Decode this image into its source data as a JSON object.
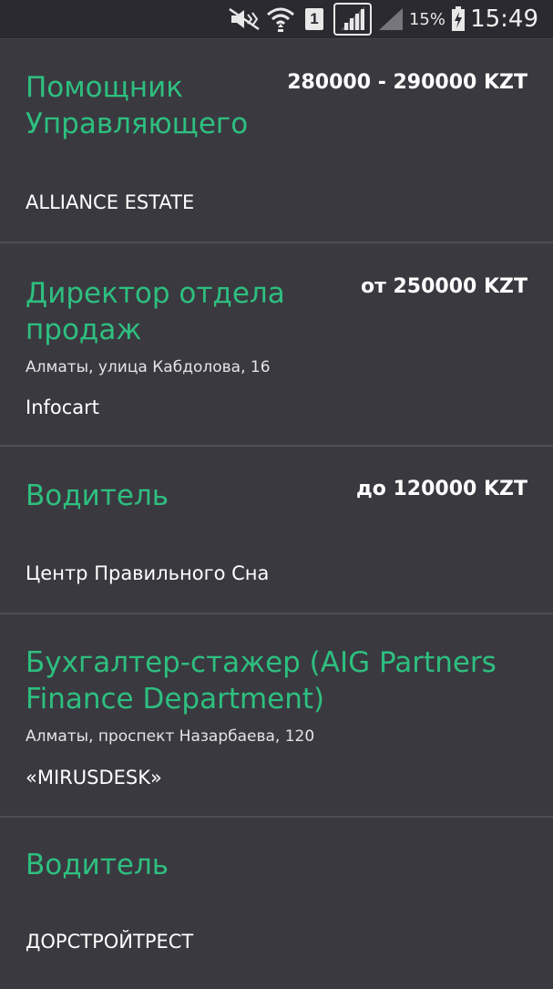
{
  "status_bar": {
    "sim_slot": "1",
    "battery_percent": "15%",
    "time": "15:49",
    "icons": [
      "mute-icon",
      "wifi-icon",
      "sim-icon",
      "signal-icon",
      "signal-weak-icon",
      "battery-charging-icon"
    ]
  },
  "jobs": [
    {
      "title": "Помощник Управляющего",
      "salary": "280000 - 290000 KZT",
      "address": "",
      "company": "ALLIANCE ESTATE"
    },
    {
      "title": "Директор отдела продаж",
      "salary": "от 250000 KZT",
      "address": "Алматы, улица Кабдолова, 16",
      "company": "Infocart"
    },
    {
      "title": "Водитель",
      "salary": "до 120000 KZT",
      "address": "",
      "company": "Центр Правильного Сна"
    },
    {
      "title": "Бухгалтер-стажер (AIG Partners Finance Department)",
      "salary": "",
      "address": "Алматы, проспект Назарбаева, 120",
      "company": "«MIRUSDESK»"
    },
    {
      "title": "Водитель",
      "salary": "",
      "address": "",
      "company": "ДОРСТРОЙТРЕСТ"
    }
  ]
}
